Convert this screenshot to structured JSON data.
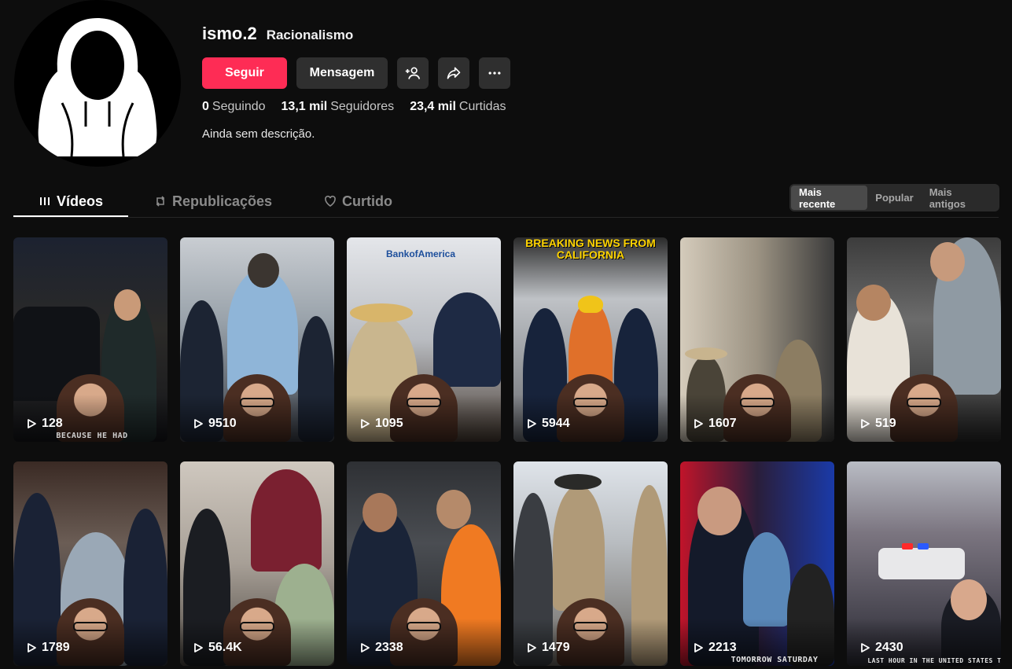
{
  "profile": {
    "username": "ismo.2",
    "nickname": "Racionalismo",
    "follow_label": "Seguir",
    "message_label": "Mensagem",
    "bio": "Ainda sem descrição.",
    "stats": [
      {
        "value": "0",
        "label": "Seguindo"
      },
      {
        "value": "13,1 mil",
        "label": "Seguidores"
      },
      {
        "value": "23,4 mil",
        "label": "Curtidas"
      }
    ]
  },
  "icons": {
    "add_friend": "person-plus-icon",
    "share": "share-arrow-icon",
    "more": "more-dots-icon"
  },
  "tabs": [
    {
      "label": "Vídeos",
      "icon": "grid-icon",
      "active": true
    },
    {
      "label": "Republicações",
      "icon": "repost-icon",
      "active": false
    },
    {
      "label": "Curtido",
      "icon": "heart-icon",
      "active": false
    }
  ],
  "sort": [
    {
      "label": "Mais recente",
      "active": true
    },
    {
      "label": "Popular",
      "active": false
    },
    {
      "label": "Mais antigos",
      "active": false
    }
  ],
  "colors": {
    "accent": "#fe2c55",
    "background": "#0d0d0d",
    "button_dark": "#2f2f2f"
  },
  "videos": [
    {
      "views": "128",
      "caption": "BECAUSE HE HAD"
    },
    {
      "views": "9510"
    },
    {
      "views": "1095",
      "sign": "BankofAmerica"
    },
    {
      "views": "5944",
      "headline": "BREAKING NEWS FROM CALIFORNIA"
    },
    {
      "views": "1607"
    },
    {
      "views": "519"
    },
    {
      "views": "1789"
    },
    {
      "views": "56.4K"
    },
    {
      "views": "2338"
    },
    {
      "views": "1479"
    },
    {
      "views": "2213",
      "caption": "TOMORROW SATURDAY"
    },
    {
      "views": "2430",
      "caption": "LAST HOUR IN THE UNITED STATES TOMORROW"
    }
  ]
}
